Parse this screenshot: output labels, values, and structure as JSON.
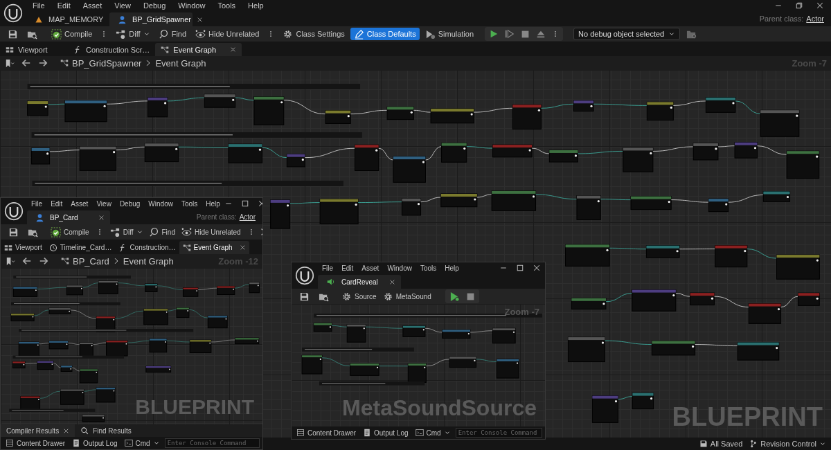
{
  "windows": [
    {
      "kind": "blueprint",
      "menu": [
        "File",
        "Edit",
        "Asset",
        "View",
        "Debug",
        "Window",
        "Tools",
        "Help"
      ],
      "documents": [
        {
          "label": "MAP_MEMORY",
          "selected": false
        },
        {
          "label": "BP_GridSpawner",
          "selected": true
        }
      ],
      "parent_class": {
        "label": "Parent class:",
        "value": "Actor"
      },
      "toolbar": [
        {
          "kind": "save"
        },
        {
          "kind": "browse"
        },
        {
          "kind": "button",
          "label": "Compile",
          "selected": false
        },
        {
          "kind": "more"
        },
        {
          "kind": "dropdown",
          "label": "Diff"
        },
        {
          "kind": "button",
          "label": "Find",
          "selected": false
        },
        {
          "kind": "button",
          "label": "Hide Unrelated",
          "selected": false
        },
        {
          "kind": "more"
        },
        {
          "kind": "button",
          "label": "Class Settings",
          "selected": false
        },
        {
          "kind": "button",
          "label": "Class Defaults",
          "selected": true
        },
        {
          "kind": "button",
          "label": "Simulation",
          "selected": false
        },
        {
          "kind": "play"
        },
        {
          "kind": "select",
          "label": "No debug object selected"
        },
        {
          "kind": "debug"
        }
      ],
      "panel_tabs": [
        {
          "label": "Viewport",
          "selected": false
        },
        {
          "label": "Construction Scr…",
          "selected": false
        },
        {
          "label": "Event Graph",
          "selected": true
        }
      ],
      "breadcrumb": [
        "BP_GridSpawner",
        "Event Graph"
      ],
      "zoom": "Zoom -7",
      "graph_label": "BLUEPRINT",
      "status_bar": [
        {
          "kind": "saved",
          "label": "All Saved"
        },
        {
          "kind": "revision",
          "label": "Revision Control"
        }
      ]
    },
    {
      "kind": "blueprint",
      "menu": [
        "File",
        "Edit",
        "Asset",
        "View",
        "Debug",
        "Window",
        "Tools",
        "Help"
      ],
      "documents": [
        {
          "label": "BP_Card",
          "selected": true
        }
      ],
      "parent_class": {
        "label": "Parent class:",
        "value": "Actor"
      },
      "toolbar": [
        {
          "kind": "save"
        },
        {
          "kind": "browse"
        },
        {
          "kind": "button",
          "label": "Compile",
          "selected": false
        },
        {
          "kind": "more"
        },
        {
          "kind": "dropdown",
          "label": "Diff"
        },
        {
          "kind": "button",
          "label": "Find",
          "selected": false
        },
        {
          "kind": "button",
          "label": "Hide Unrelated",
          "selected": false
        },
        {
          "kind": "more"
        },
        {
          "kind": "overflow"
        }
      ],
      "panel_tabs": [
        {
          "label": "Viewport",
          "selected": false
        },
        {
          "label": "Timeline_Card…",
          "selected": false
        },
        {
          "label": "Construction…",
          "selected": false
        },
        {
          "label": "Event Graph",
          "selected": true
        }
      ],
      "breadcrumb": [
        "BP_Card",
        "Event Graph"
      ],
      "zoom": "Zoom -12",
      "graph_label": "BLUEPRINT",
      "bottom_tabs": [
        {
          "label": "Compiler Results",
          "selected": true
        },
        {
          "label": "Find Results",
          "selected": false
        }
      ],
      "status_bar": [
        {
          "kind": "drawer",
          "label": "Content Drawer"
        },
        {
          "kind": "log",
          "label": "Output Log"
        },
        {
          "kind": "cmd",
          "label": "Cmd"
        },
        {
          "kind": "console",
          "placeholder": "Enter Console Command"
        }
      ]
    },
    {
      "kind": "metasound",
      "menu": [
        "File",
        "Edit",
        "Asset",
        "Window",
        "Tools",
        "Help"
      ],
      "documents": [
        {
          "label": "CardReveal",
          "selected": true
        }
      ],
      "toolbar": [
        {
          "kind": "save"
        },
        {
          "kind": "browse"
        },
        {
          "kind": "button",
          "label": "Source",
          "selected": false
        },
        {
          "kind": "button",
          "label": "MetaSound",
          "selected": false
        },
        {
          "kind": "audition"
        }
      ],
      "zoom": "Zoom -7",
      "graph_label": "MetaSoundSource",
      "status_bar": [
        {
          "kind": "drawer",
          "label": "Content Drawer"
        },
        {
          "kind": "log",
          "label": "Output Log"
        },
        {
          "kind": "cmd",
          "label": "Cmd"
        },
        {
          "kind": "console",
          "placeholder": "Enter Console Command"
        }
      ]
    }
  ]
}
